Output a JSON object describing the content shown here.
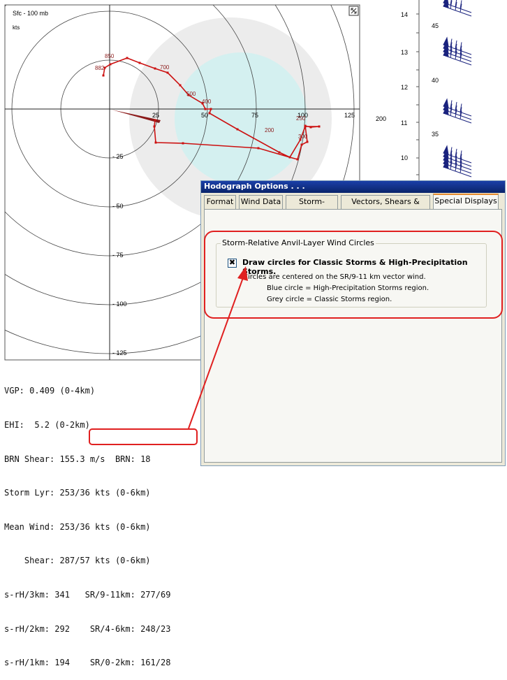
{
  "hodograph": {
    "title": "Sfc - 100 mb",
    "units": "kts",
    "x_ticks": [
      "25",
      "50",
      "75",
      "100",
      "125"
    ],
    "y_ticks": [
      "- 25",
      "- 50",
      "- 75",
      "- 100",
      "- 125"
    ],
    "level_labels": [
      "850",
      "882",
      "700",
      "500",
      "400",
      "250",
      "200",
      "300"
    ],
    "colors": {
      "trace": "#cc1111",
      "grey_circle": "#ececec",
      "blue_circle": "#d4f0f0",
      "ring": "#444444"
    }
  },
  "stats": [
    "VGP: 0.409 (0-4km)",
    "EHI:  5.2 (0-2km)",
    "BRN Shear: 155.3 m/s  BRN: 18",
    "Storm Lyr: 253/36 kts (0-6km)",
    "Mean Wind: 253/36 kts (0-6km)",
    "    Shear: 287/57 kts (0-6km)",
    "s-rH/3km: 341   SR/9-11km: 277/69",
    "s-rH/2km: 292    SR/4-6km: 248/23",
    "s-rH/1km: 194    SR/0-2km: 161/28"
  ],
  "skewt": {
    "pressure_label": "200",
    "height_labels": [
      "14",
      "13",
      "12",
      "11",
      "10"
    ],
    "temp_labels": [
      "45",
      "40",
      "35"
    ]
  },
  "dialog": {
    "title": "Hodograph Options . . .",
    "tabs": [
      "Format",
      "Wind Data",
      "Storm-Motion",
      "Vectors, Shears & Helicity",
      "Special Displays"
    ],
    "active_tab": "Special Displays",
    "group_title": "Storm-Relative Anvil-Layer Wind Circles",
    "checkbox_label": "Draw circles for Classic Storms & High-Precipitation Storms.",
    "checkbox_checked": true,
    "check_mark": "✖",
    "note_1": "Circles are centered on the SR/9-11 km vector wind.",
    "note_2": "Blue circle = High-Precipitation Storms region.",
    "note_3": "Grey circle = Classic Storms region."
  }
}
